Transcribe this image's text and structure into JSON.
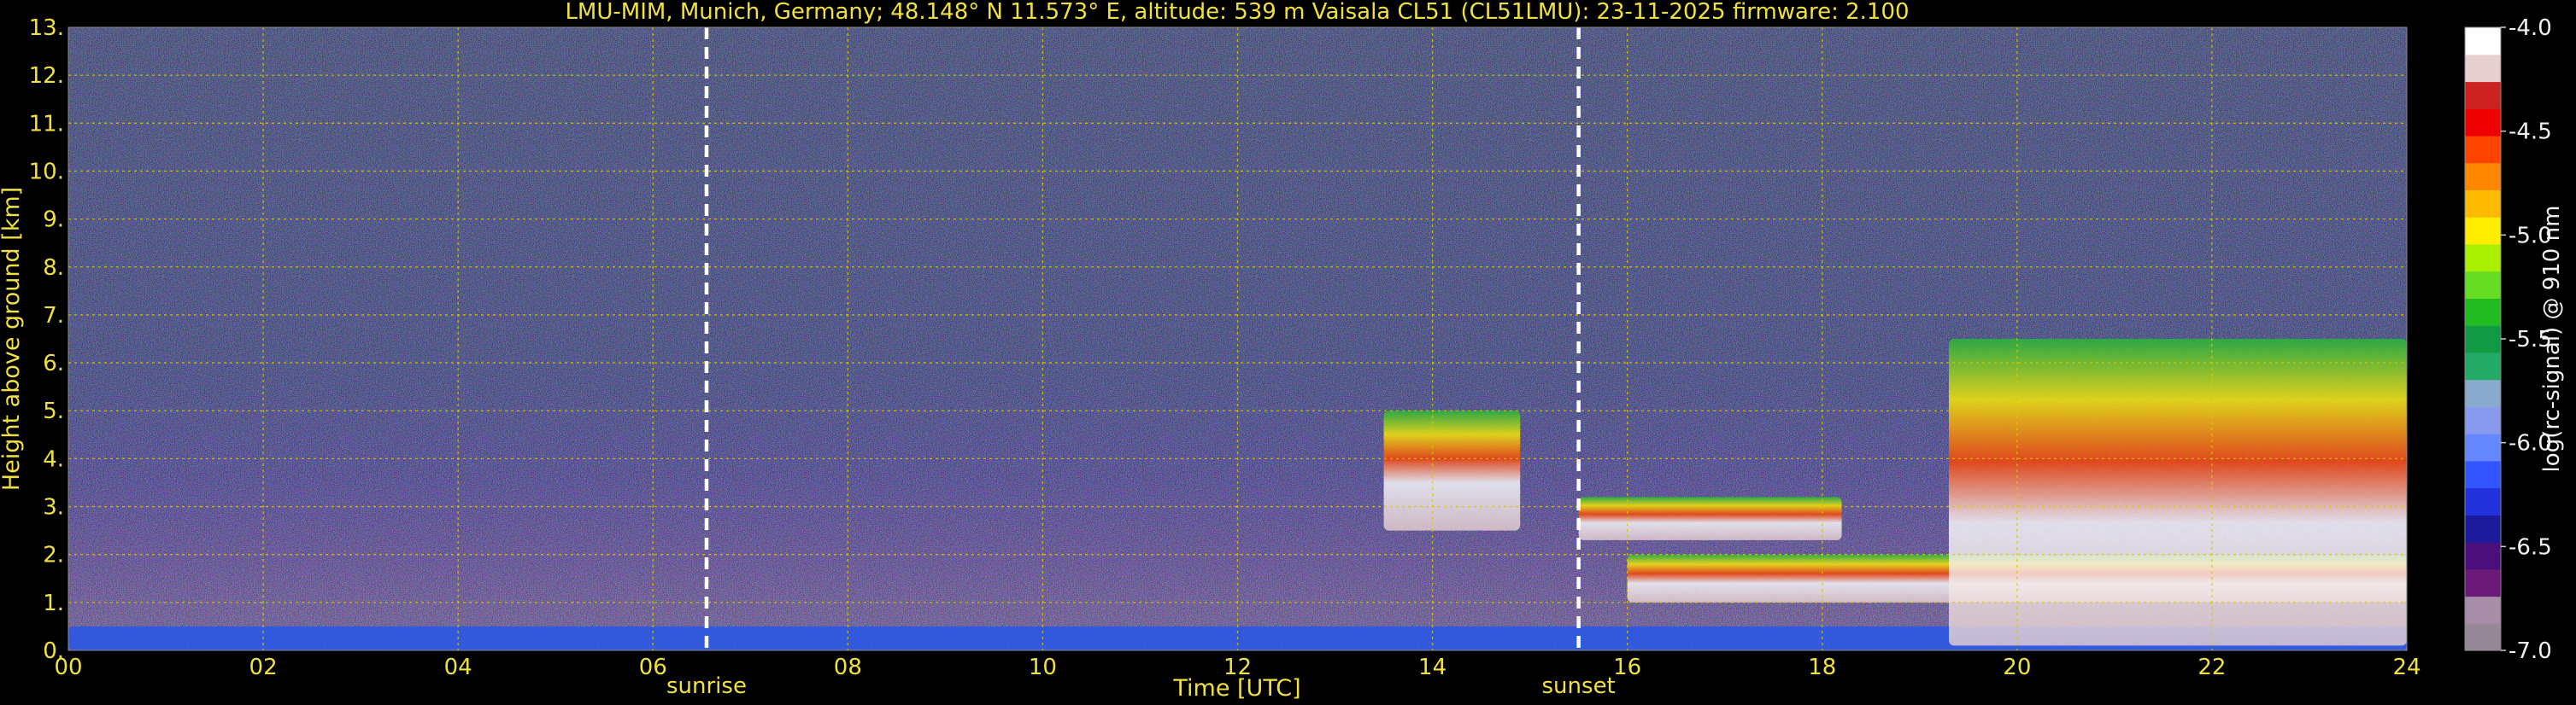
{
  "chart_data": {
    "type": "heatmap",
    "title": "LMU-MIM, Munich, Germany; 48.148° N 11.573° E, altitude: 539 m    Vaisala CL51 (CL51LMU): 23-11-2025    firmware: 2.100",
    "xlabel": "Time [UTC]",
    "ylabel": "Height above ground [km]",
    "xlim": [
      0,
      24
    ],
    "ylim": [
      0,
      13
    ],
    "x_ticks": [
      "00",
      "02",
      "04",
      "06",
      "08",
      "10",
      "12",
      "14",
      "16",
      "18",
      "20",
      "22",
      "24"
    ],
    "y_ticks": [
      "0.",
      "1.",
      "2.",
      "3.",
      "4.",
      "5.",
      "6.",
      "7.",
      "8.",
      "9.",
      "10.",
      "11.",
      "12.",
      "13."
    ],
    "grid": true,
    "vlines": [
      {
        "label": "sunrise",
        "x": 6.55
      },
      {
        "label": "sunset",
        "x": 15.5
      }
    ],
    "colorbar": {
      "label": "log(rc-signal) @ 910 nm",
      "ticks": [
        "-4.0",
        "-4.5",
        "-5.0",
        "-5.5",
        "-6.0",
        "-6.5",
        "-7.0"
      ],
      "range": [
        -7.0,
        -4.0
      ],
      "colors": [
        "#968896",
        "#a78da7",
        "#6c1a7a",
        "#4a0f7a",
        "#1a1a9a",
        "#2233dd",
        "#3355ff",
        "#6688ff",
        "#8899ee",
        "#88aacc",
        "#22aa66",
        "#119944",
        "#22bb22",
        "#66dd22",
        "#aaee00",
        "#ffee00",
        "#ffbb00",
        "#ff8800",
        "#ff4400",
        "#ee0000",
        "#cc2222",
        "#e8d0d0",
        "#ffffff"
      ]
    },
    "features": [
      {
        "name": "surface layer",
        "t": [
          0,
          24
        ],
        "z": [
          0.0,
          0.5
        ]
      },
      {
        "name": "cloud",
        "t": [
          13.5,
          14.9
        ],
        "z": [
          2.5,
          5.0
        ]
      },
      {
        "name": "cloud",
        "t": [
          15.5,
          18.2
        ],
        "z": [
          2.3,
          3.2
        ]
      },
      {
        "name": "cloud",
        "t": [
          16.0,
          24.0
        ],
        "z": [
          1.0,
          2.0
        ]
      },
      {
        "name": "cloud",
        "t": [
          19.3,
          24.0
        ],
        "z": [
          0.1,
          6.5
        ]
      }
    ]
  }
}
